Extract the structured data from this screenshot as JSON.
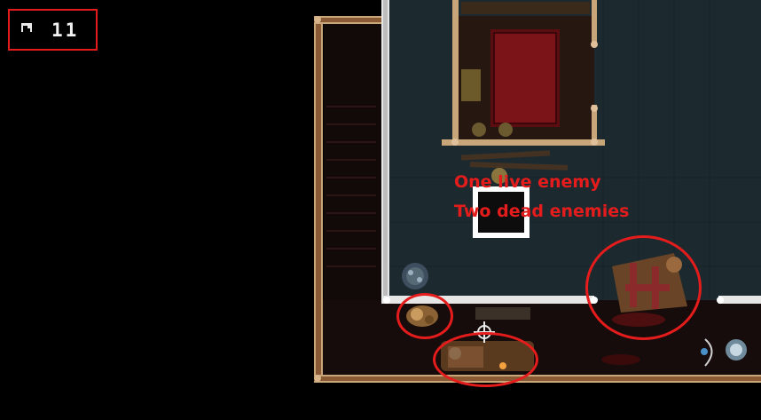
{
  "hud": {
    "icon": "mailbox-icon",
    "count": "11"
  },
  "annotations": {
    "line1": "One live enemy",
    "line2": "Two dead enemies"
  },
  "colors": {
    "annotation_red": "#e41c1c",
    "floor": "#1d2a30",
    "wall_trim": "#c9a57a"
  }
}
